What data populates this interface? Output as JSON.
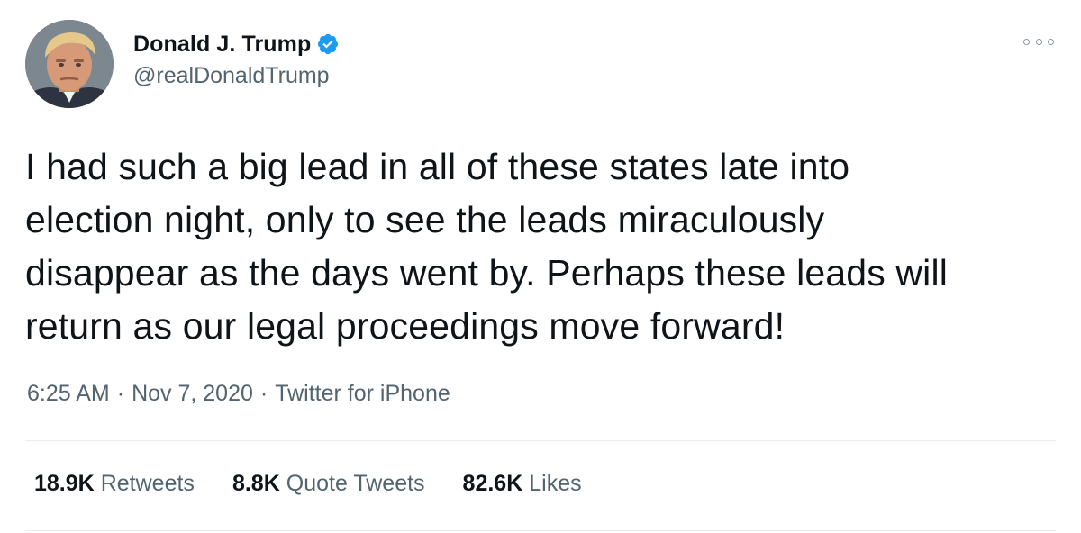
{
  "author": {
    "display_name": "Donald J. Trump",
    "handle": "@realDonaldTrump",
    "verified": true,
    "avatar_icon": "profile-photo",
    "verified_color": "#1d9bf0"
  },
  "tweet": {
    "text": "I had such a big lead in all of these states late into\nelection night, only to see the leads miraculously\ndisappear as the days went by. Perhaps these leads will\nreturn as our legal proceedings move forward!"
  },
  "meta": {
    "time": "6:25 AM",
    "separator": "·",
    "date": "Nov 7, 2020",
    "source": "Twitter for iPhone"
  },
  "stats": [
    {
      "value": "18.9K",
      "label": "Retweets"
    },
    {
      "value": "8.8K",
      "label": "Quote Tweets"
    },
    {
      "value": "82.6K",
      "label": "Likes"
    }
  ],
  "menu": {
    "icon": "more-options-icon"
  },
  "colors": {
    "text_primary": "#0f1419",
    "text_secondary": "#536471",
    "divider": "#e6ecf0"
  }
}
